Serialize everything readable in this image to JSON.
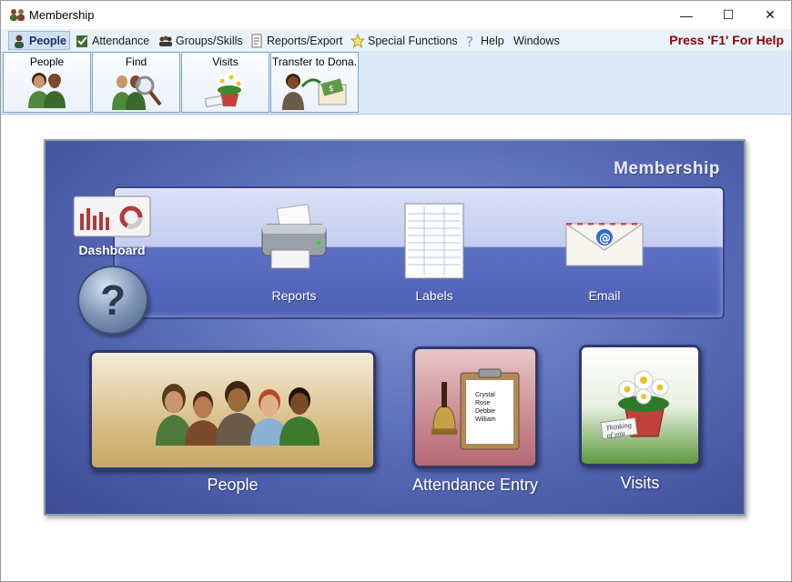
{
  "window": {
    "title": "Membership",
    "controls": {
      "minimize": "—",
      "maximize": "☐",
      "close": "✕"
    }
  },
  "menu": {
    "items": [
      {
        "label": "People",
        "icon": "person-icon"
      },
      {
        "label": "Attendance",
        "icon": "checklist-icon"
      },
      {
        "label": "Groups/Skills",
        "icon": "group-icon"
      },
      {
        "label": "Reports/Export",
        "icon": "report-icon"
      },
      {
        "label": "Special Functions",
        "icon": "star-icon"
      },
      {
        "label": "Help",
        "icon": "question-icon"
      },
      {
        "label": "Windows",
        "icon": ""
      }
    ],
    "help_hint": "Press 'F1' For Help"
  },
  "toolbar": {
    "buttons": [
      {
        "label": "People",
        "icon": "people-icon"
      },
      {
        "label": "Find",
        "icon": "find-people-icon"
      },
      {
        "label": "Visits",
        "icon": "flowers-icon"
      },
      {
        "label": "Transfer to Dona.",
        "icon": "transfer-money-icon"
      }
    ]
  },
  "main": {
    "title": "Membership",
    "shelf": {
      "dashboard_label": "Dashboard",
      "reports_label": "Reports",
      "labels_label": "Labels",
      "email_label": "Email",
      "help_symbol": "?"
    },
    "tiles": {
      "people_label": "People",
      "attendance_label": "Attendance Entry",
      "visits_label": "Visits",
      "clipboard_names": [
        "Crystal",
        "Rose",
        "Debbie",
        "William"
      ],
      "card_text": "Thinking of you"
    }
  },
  "colors": {
    "help_hint": "#8b0000",
    "panel": "#5568b5",
    "menu_bg": "#eaf2fb"
  }
}
